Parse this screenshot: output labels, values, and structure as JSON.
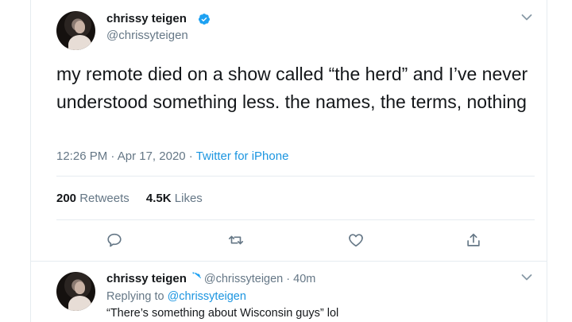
{
  "tweet": {
    "display_name": "chrissy teigen",
    "handle": "@chrissyteigen",
    "text": "my remote died on a show called “the herd” and I’ve never understood something less. the names, the terms, nothing",
    "time": "12:26 PM",
    "date": "Apr 17, 2020",
    "source": "Twitter for iPhone",
    "retweets_count": "200",
    "retweets_label": "Retweets",
    "likes_count": "4.5K",
    "likes_label": "Likes"
  },
  "reply": {
    "display_name": "chrissy teigen",
    "handle": "@chrissyteigen",
    "age": "40m",
    "replying_prefix": "Replying to",
    "replying_to": "@chrissyteigen",
    "text": "“There’s something about Wisconsin guys” lol"
  },
  "icons": {
    "verified": "verified-badge-icon",
    "menu": "chevron-down-icon",
    "reply": "comment-icon",
    "retweet": "retweet-icon",
    "like": "heart-icon",
    "share": "share-icon"
  },
  "colors": {
    "text": "#14171a",
    "secondary": "#657786",
    "link": "#1b95e0",
    "verified": "#1da1f2",
    "divider": "#e6ecf0"
  }
}
